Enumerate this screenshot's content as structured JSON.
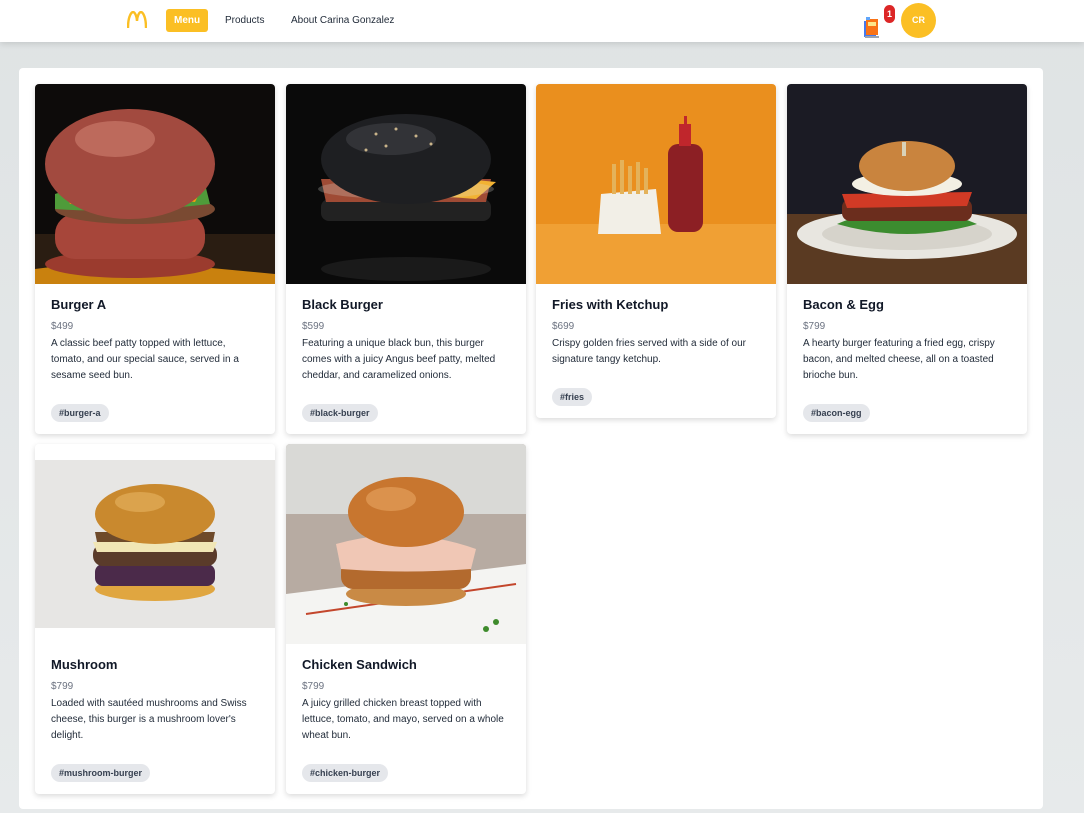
{
  "nav": {
    "logo_icon": "mcdonalds-arches-icon",
    "items": [
      {
        "label": "Menu",
        "active": true
      },
      {
        "label": "Products",
        "active": false
      },
      {
        "label": "About Carina Gonzalez",
        "active": false
      }
    ],
    "cart_icon": "shopping-bag-icon",
    "cart_count": "1",
    "avatar_initials": "CR"
  },
  "colors": {
    "accent": "#fbbf24",
    "badge": "#dc2626"
  },
  "products": [
    {
      "title": "Burger A",
      "price": "$499",
      "description": "A classic beef patty topped with lettuce, tomato, and our special sauce, served in a sesame seed bun.",
      "tag": "#burger-a"
    },
    {
      "title": "Black Burger",
      "price": "$599",
      "description": "Featuring a unique black bun, this burger comes with a juicy Angus beef patty, melted cheddar, and caramelized onions.",
      "tag": "#black-burger"
    },
    {
      "title": "Fries with Ketchup",
      "price": "$699",
      "description": "Crispy golden fries served with a side of our signature tangy ketchup.",
      "tag": "#fries"
    },
    {
      "title": "Bacon & Egg",
      "price": "$799",
      "description": "A hearty burger featuring a fried egg, crispy bacon, and melted cheese, all on a toasted brioche bun.",
      "tag": "#bacon-egg"
    },
    {
      "title": "Mushroom",
      "price": "$799",
      "description": "Loaded with sautéed mushrooms and Swiss cheese, this burger is a mushroom lover's delight.",
      "tag": "#mushroom-burger"
    },
    {
      "title": "Chicken Sandwich",
      "price": "$799",
      "description": "A juicy grilled chicken breast topped with lettuce, tomato, and mayo, served on a whole wheat bun.",
      "tag": "#chicken-burger"
    }
  ]
}
